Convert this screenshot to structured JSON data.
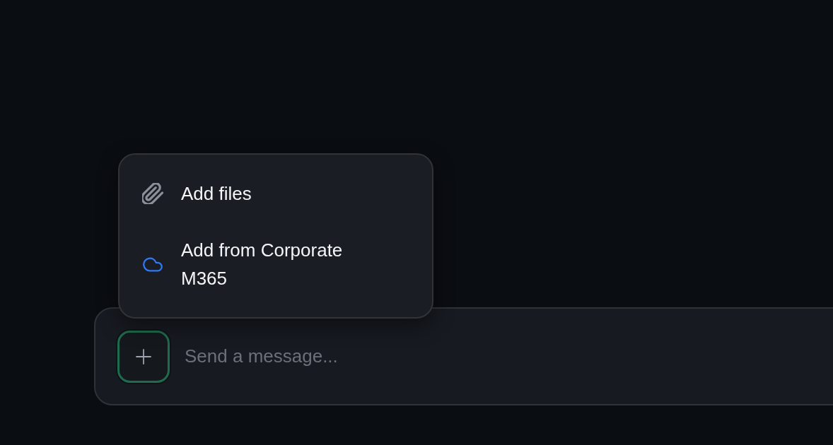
{
  "attach_menu": {
    "items": [
      {
        "kind": "files",
        "label": "Add files"
      },
      {
        "kind": "cloud",
        "label": "Add from Corporate M365"
      }
    ]
  },
  "composer": {
    "placeholder": "Send a message..."
  }
}
